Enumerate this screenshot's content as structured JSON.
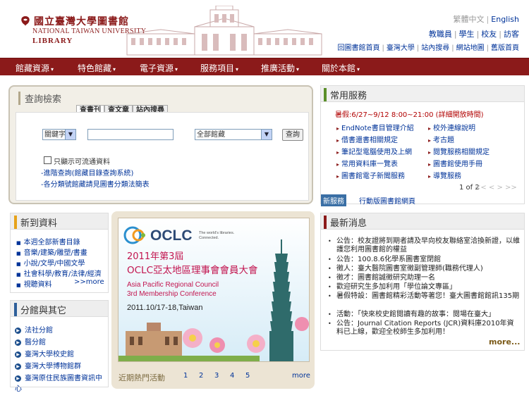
{
  "header": {
    "logo_cn": "國立臺灣大學圖書館",
    "logo_en_line1": "NATIONAL TAIWAN UNIVERSITY",
    "logo_en_line2": "LIBRARY",
    "lang_trad": "繁體中文",
    "lang_en": "English",
    "roles": [
      "教職員",
      "學生",
      "校友",
      "訪客"
    ],
    "quick_links": [
      "回圖書館首頁",
      "臺灣大學",
      "站內搜尋",
      "網站地圖",
      "舊版首頁"
    ]
  },
  "nav": {
    "items": [
      "館藏資源",
      "特色館藏",
      "電子資源",
      "服務項目",
      "推廣活動",
      "關於本館"
    ]
  },
  "search": {
    "title": "查詢檢索",
    "tabs": [
      "查書刊",
      "查文章",
      "站內搜尋"
    ],
    "field_select": "關鍵字",
    "scope_select": "全部館藏",
    "button": "查詢",
    "checkbox_label": "只顯示可流通資料",
    "link_advanced": "-進階查詢(館藏目錄查詢系統)",
    "link_call_number": "-各分類號館藏請見圖書分類法簡表"
  },
  "services": {
    "title": "常用服務",
    "hours": "暑假:6/27~9/12 8:00~21:00 (詳細開放時間)",
    "left_items": [
      "EndNote書目管理介紹",
      "借書還書相關規定",
      "筆記型電腦使用及上網",
      "常用資料庫一覽表",
      "圖書館電子新聞服務"
    ],
    "right_items": [
      "校外連線說明",
      "考古題",
      "閱覽服務相關規定",
      "圖書館使用手冊",
      "導覽服務"
    ],
    "page": "1 of 2",
    "arrows": "<< < > >>",
    "badge": "新服務",
    "mobile": "行動版圖書館網頁"
  },
  "new_resources": {
    "title": "新到資料",
    "items": [
      "本週全部新書目錄",
      "音樂/建築/雕塑/書畫",
      "小說/文學/中國文學",
      "社會科學/教育/法律/經濟",
      "視聽資料"
    ],
    "more": ">>more"
  },
  "branches": {
    "title": "分館與其它",
    "items": [
      "法社分館",
      "醫分館",
      "臺灣大學校史館",
      "臺灣大學博物館群",
      "臺灣原住民族圖書資訊中心"
    ]
  },
  "banner": {
    "brand": "OCLC",
    "tagline_1": "The world's libraries.",
    "tagline_2": "Connected.",
    "headline_1": "2011年第3屆",
    "headline_2": "OCLC亞太地區理事會會員大會",
    "sub_1": "Asia Pacific Regional Council",
    "sub_2": "3rd Membership Conference",
    "date": "2011.10/17-18,Taiwan",
    "hot_label": "近期熱門活動",
    "hot_pages": [
      "1",
      "2",
      "3",
      "4",
      "5"
    ],
    "more": "more"
  },
  "news": {
    "title": "最新消息",
    "items": [
      "公告：校友證將到期者請及早向校友聯絡室洽換新證，以維護您利用圖書館的權益",
      "公告：100.8.6化學系圖書室閉館",
      "徵人：臺大醫院圖書室徵副管理師(職務代理人)",
      "徵才：圖書館誠徵研究助理一名",
      "歡迎研究生多加利用「學位論文專區」",
      "暑假特設：圖書館精彩活動等著您！臺大圖書館館訊135期",
      "活動：「快來校史館閱讀有趣的故事：閱場在臺大」",
      "公告：Journal Citation Reports (JCR)資料庫2010年資料已上線，歡迎全校師生多加利用！"
    ],
    "more": "more..."
  },
  "colors": {
    "brand_red": "#8b1a1a",
    "link_blue": "#003399",
    "services_green": "#5a8f29",
    "resources_gold": "#e6a21a"
  }
}
